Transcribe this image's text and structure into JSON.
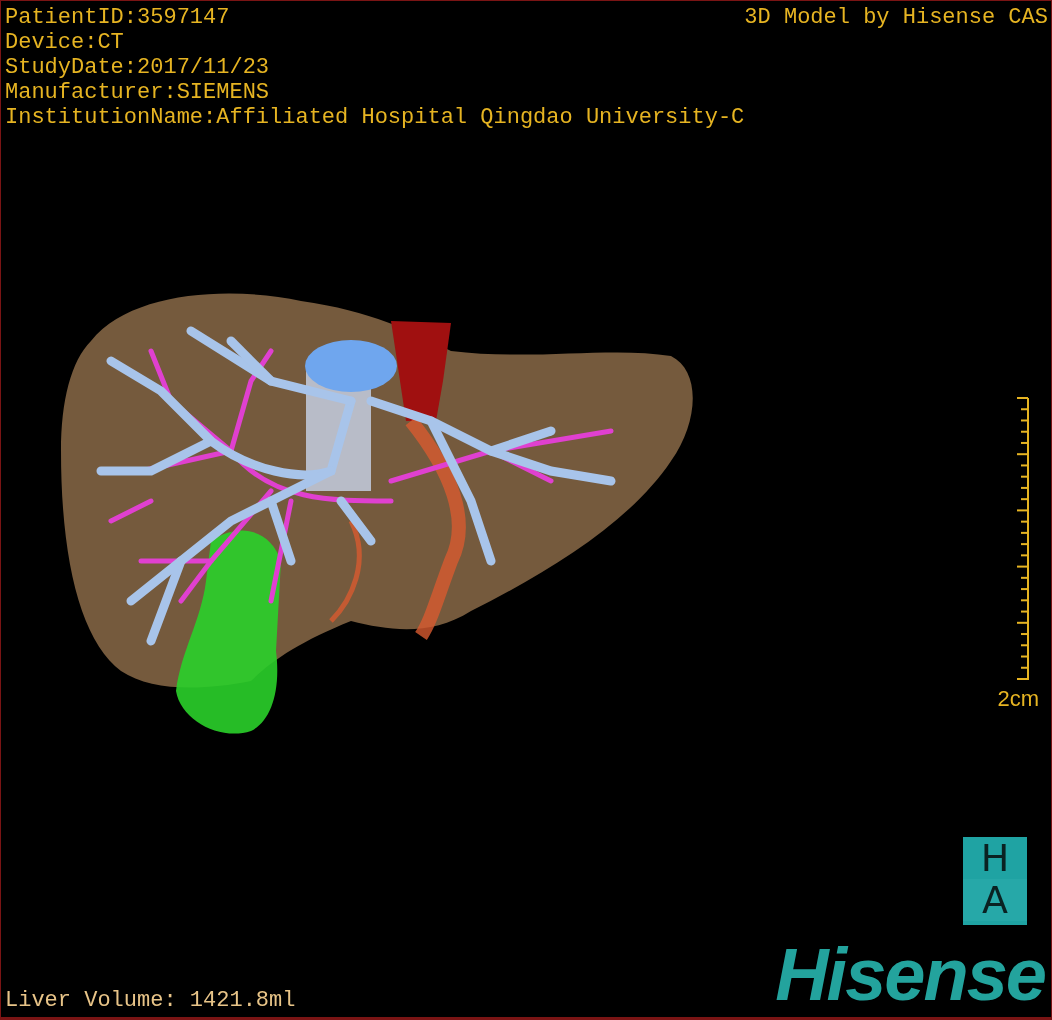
{
  "info_lines": [
    "PatientID:3597147",
    "Device:CT",
    "StudyDate:2017/11/23",
    "Manufacturer:SIEMENS",
    "InstitutionName:Affiliated Hospital Qingdao University-C"
  ],
  "credit": "3D Model by Hisense CAS",
  "scale_bar": {
    "label": "2cm"
  },
  "measurement": "Liver Volume: 1421.8ml",
  "logos": {
    "badge_letters": [
      "H",
      "A"
    ],
    "brand": "Hisense"
  }
}
